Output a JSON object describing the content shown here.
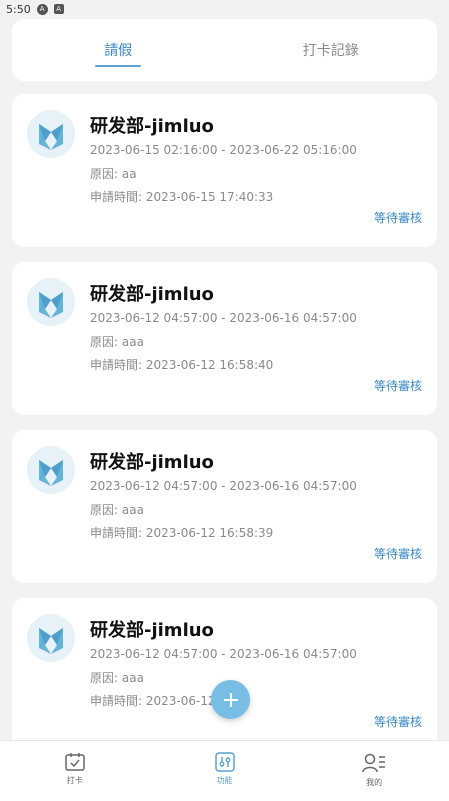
{
  "status_bar": {
    "time": "5:50"
  },
  "tabs": [
    {
      "label": "請假",
      "active": true
    },
    {
      "label": "打卡記錄",
      "active": false
    }
  ],
  "records": [
    {
      "title": "研发部-jimluo",
      "period": "2023-06-15 02:16:00 - 2023-06-22 05:16:00",
      "reason": "原因: aa",
      "apply_time": "申請時間: 2023-06-15 17:40:33",
      "status": "等待審核"
    },
    {
      "title": "研发部-jimluo",
      "period": "2023-06-12 04:57:00 - 2023-06-16 04:57:00",
      "reason": "原因: aaa",
      "apply_time": "申請時間: 2023-06-12 16:58:40",
      "status": "等待審核"
    },
    {
      "title": "研发部-jimluo",
      "period": "2023-06-12 04:57:00 - 2023-06-16 04:57:00",
      "reason": "原因: aaa",
      "apply_time": "申請時間: 2023-06-12 16:58:39",
      "status": "等待審核"
    },
    {
      "title": "研发部-jimluo",
      "period": "2023-06-12 04:57:00 - 2023-06-16 04:57:00",
      "reason": "原因: aaa",
      "apply_time": "申請時間: 2023-06-12 1",
      "status": "等待審核"
    }
  ],
  "bottom_nav": [
    {
      "label": "打卡",
      "icon": "calendar-check-icon",
      "active": false
    },
    {
      "label": "功能",
      "icon": "sliders-icon",
      "active": true
    },
    {
      "label": "我的",
      "icon": "user-list-icon",
      "active": false
    }
  ],
  "colors": {
    "accent": "#3b86c4",
    "fab": "#78bde4",
    "background": "#f2f2f2"
  }
}
